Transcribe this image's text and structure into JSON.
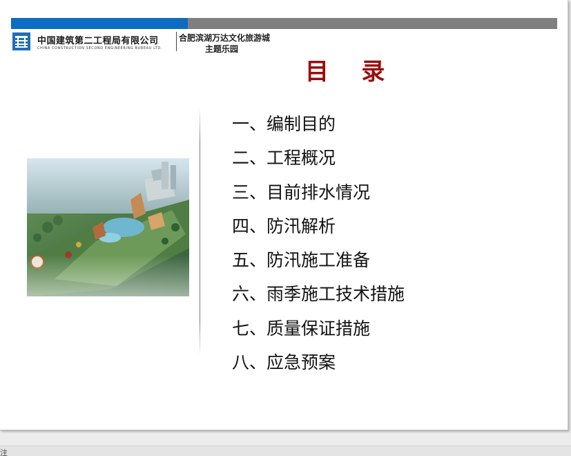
{
  "header": {
    "company_cn": "中国建筑第二工程局有限公司",
    "company_en": "CHINA CONSTRUCTION SECOND ENGINEERING BUREAU LTD.",
    "project_line1": "合肥滨湖万达文化旅游城",
    "project_line2": "主题乐园",
    "bar_colors": {
      "left": "#0b6cc2",
      "right": "#7f7f7f"
    },
    "logo_icon": "cscec-logo-icon"
  },
  "title": "目    录",
  "title_color": "#9b0d0d",
  "image": {
    "subject": "theme-park-aerial-rendering"
  },
  "toc": [
    "一、编制目的",
    "二、工程概况",
    "三、目前排水情况",
    "四、防汛解析",
    "五、防汛施工准备",
    "六、雨季施工技术措施",
    "七、质量保证措施",
    "八、应急预案"
  ],
  "status": {
    "notes_label": "注"
  }
}
